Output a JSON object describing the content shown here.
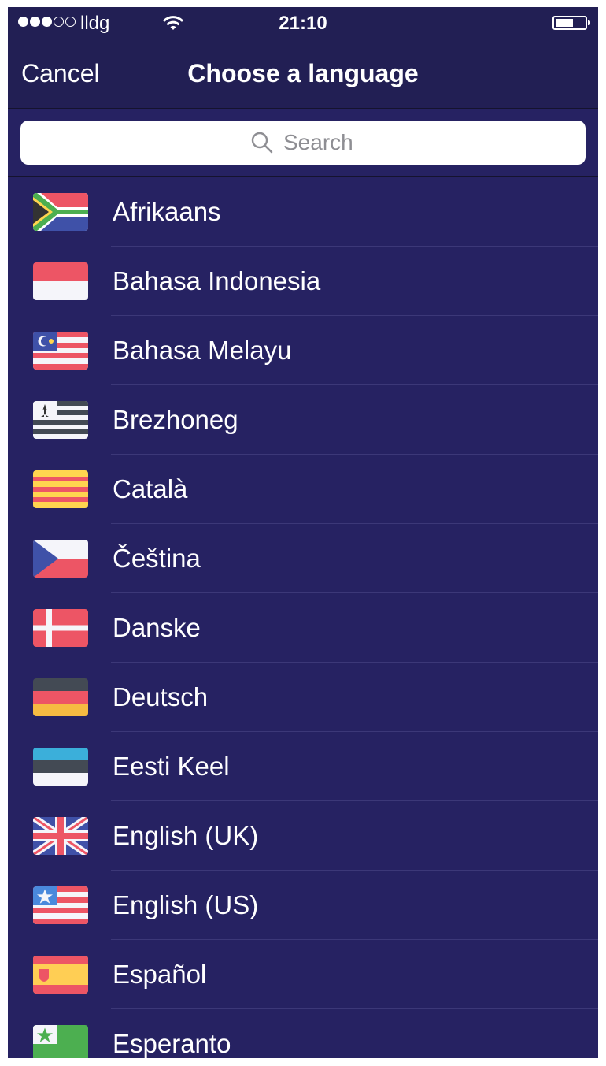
{
  "status_bar": {
    "carrier": "lldg",
    "time": "21:10"
  },
  "nav": {
    "cancel_label": "Cancel",
    "title": "Choose a language"
  },
  "search": {
    "placeholder": "Search"
  },
  "languages": [
    {
      "label": "Afrikaans",
      "flag": "za-flag-icon"
    },
    {
      "label": "Bahasa Indonesia",
      "flag": "id-flag-icon"
    },
    {
      "label": "Bahasa Melayu",
      "flag": "my-flag-icon"
    },
    {
      "label": "Brezhoneg",
      "flag": "brittany-flag-icon"
    },
    {
      "label": "Català",
      "flag": "catalonia-flag-icon"
    },
    {
      "label": "Čeština",
      "flag": "cz-flag-icon"
    },
    {
      "label": "Danske",
      "flag": "dk-flag-icon"
    },
    {
      "label": "Deutsch",
      "flag": "de-flag-icon"
    },
    {
      "label": "Eesti Keel",
      "flag": "ee-flag-icon"
    },
    {
      "label": "English (UK)",
      "flag": "gb-flag-icon"
    },
    {
      "label": "English (US)",
      "flag": "us-flag-icon"
    },
    {
      "label": "Español",
      "flag": "es-flag-icon"
    },
    {
      "label": "Esperanto",
      "flag": "esperanto-flag-icon"
    }
  ],
  "colors": {
    "background": "#262262",
    "header": "#221f54",
    "text": "#ffffff",
    "divider": "#3c3878"
  }
}
